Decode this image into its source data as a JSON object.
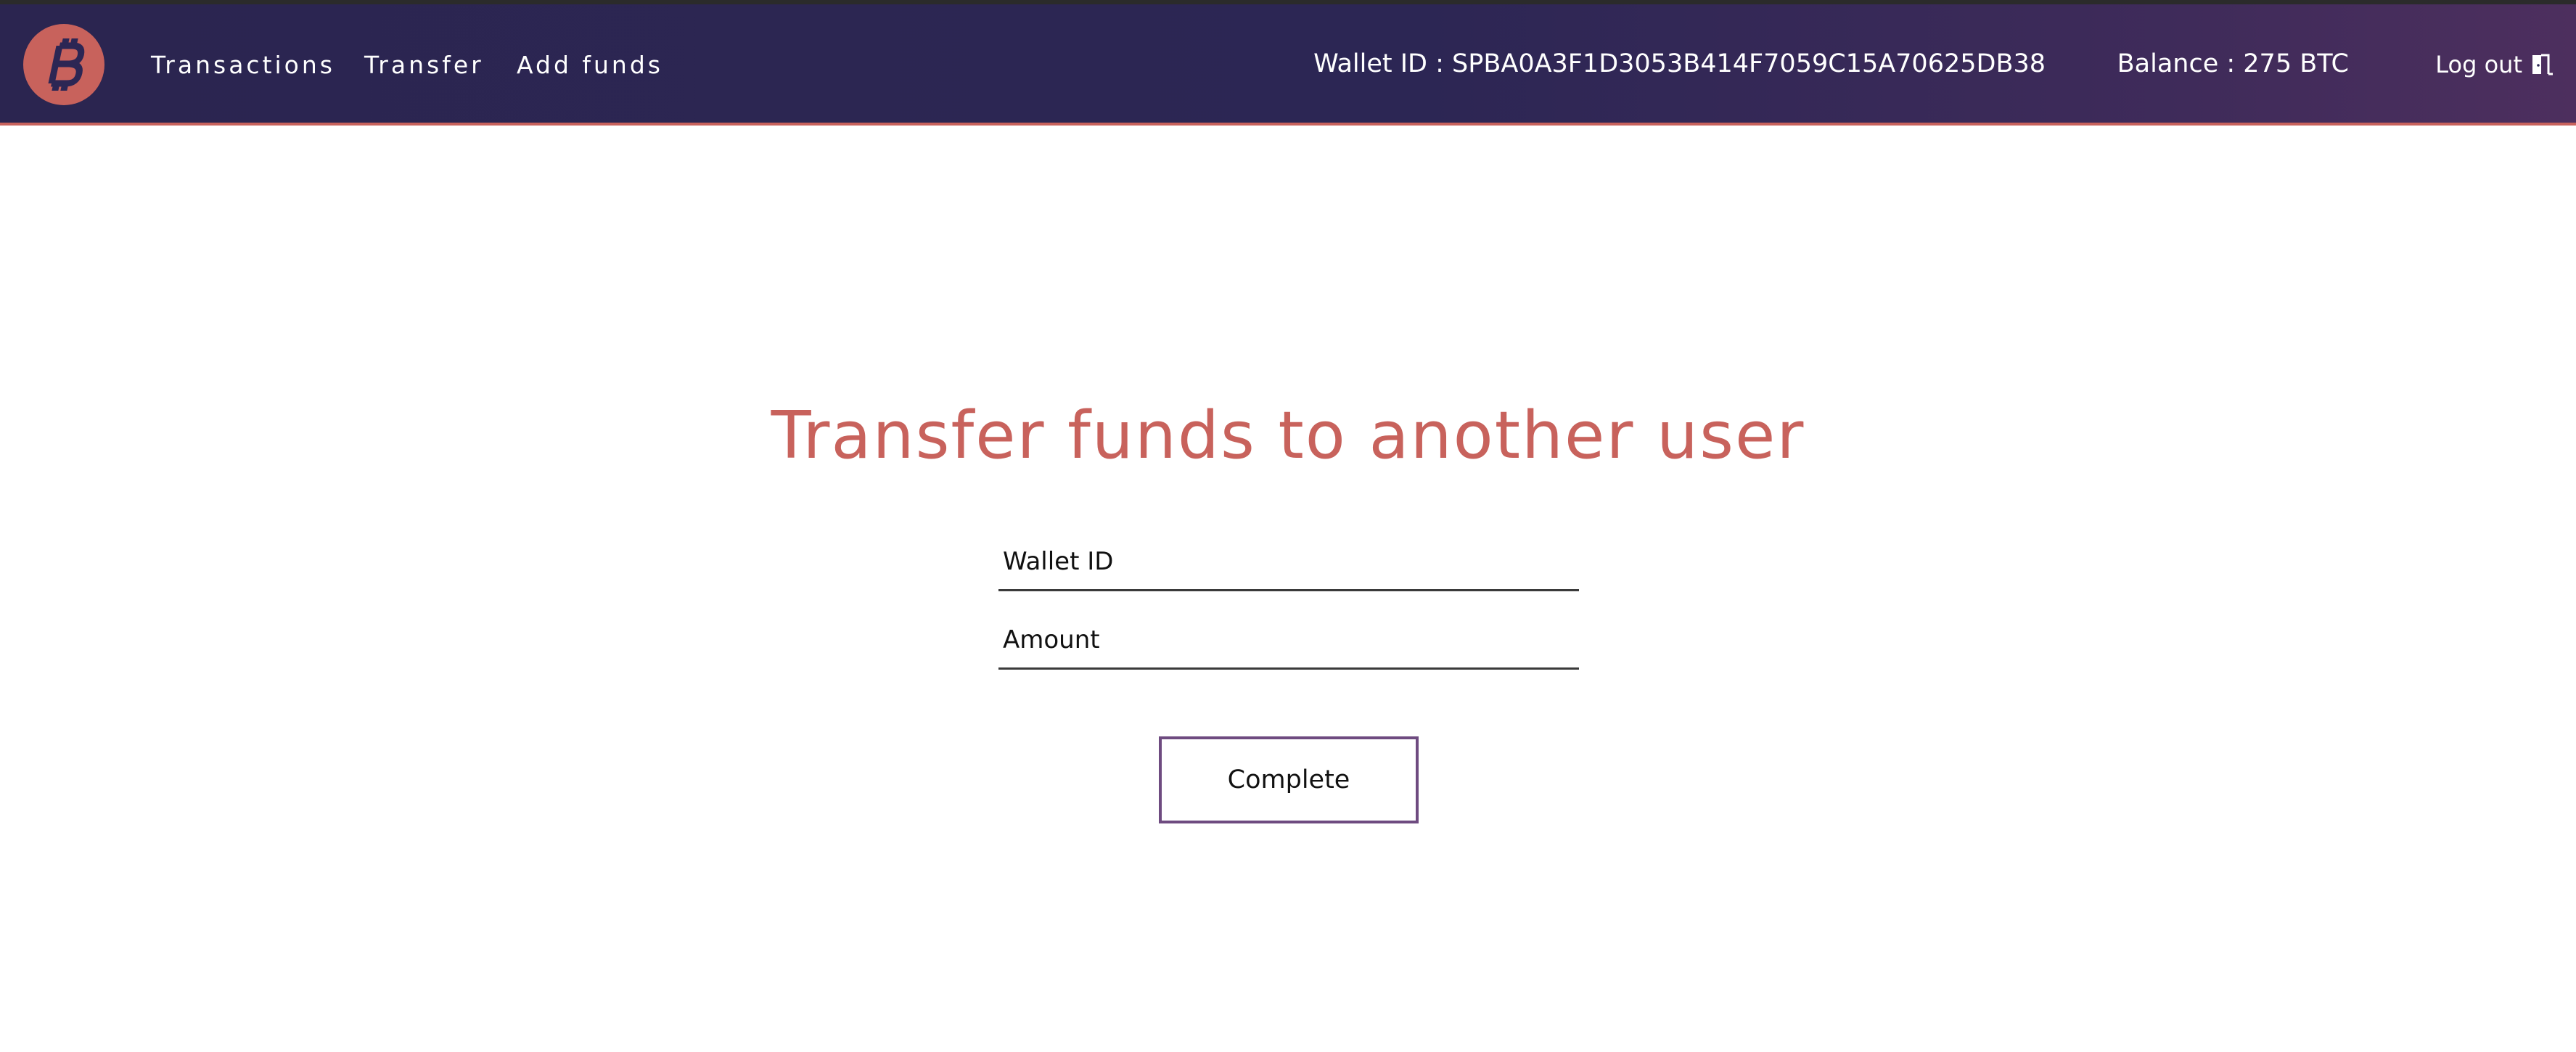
{
  "nav": {
    "logo_icon": "bitcoin-icon",
    "links": [
      "Transactions",
      "Transfer",
      "Add funds"
    ],
    "wallet_id_text": "Wallet ID : SPBA0A3F1D3053B414F7059C15A70625DB38",
    "balance_text": "Balance : 275 BTC",
    "logout_label": "Log out",
    "logout_icon": "door-exit-icon"
  },
  "main": {
    "title": "Transfer funds to another user",
    "wallet_id_placeholder": "Wallet ID",
    "amount_placeholder": "Amount",
    "submit_label": "Complete"
  },
  "colors": {
    "navbar_bg": "#2c2654",
    "accent": "#c8625c",
    "button_border": "#6e4b80"
  }
}
